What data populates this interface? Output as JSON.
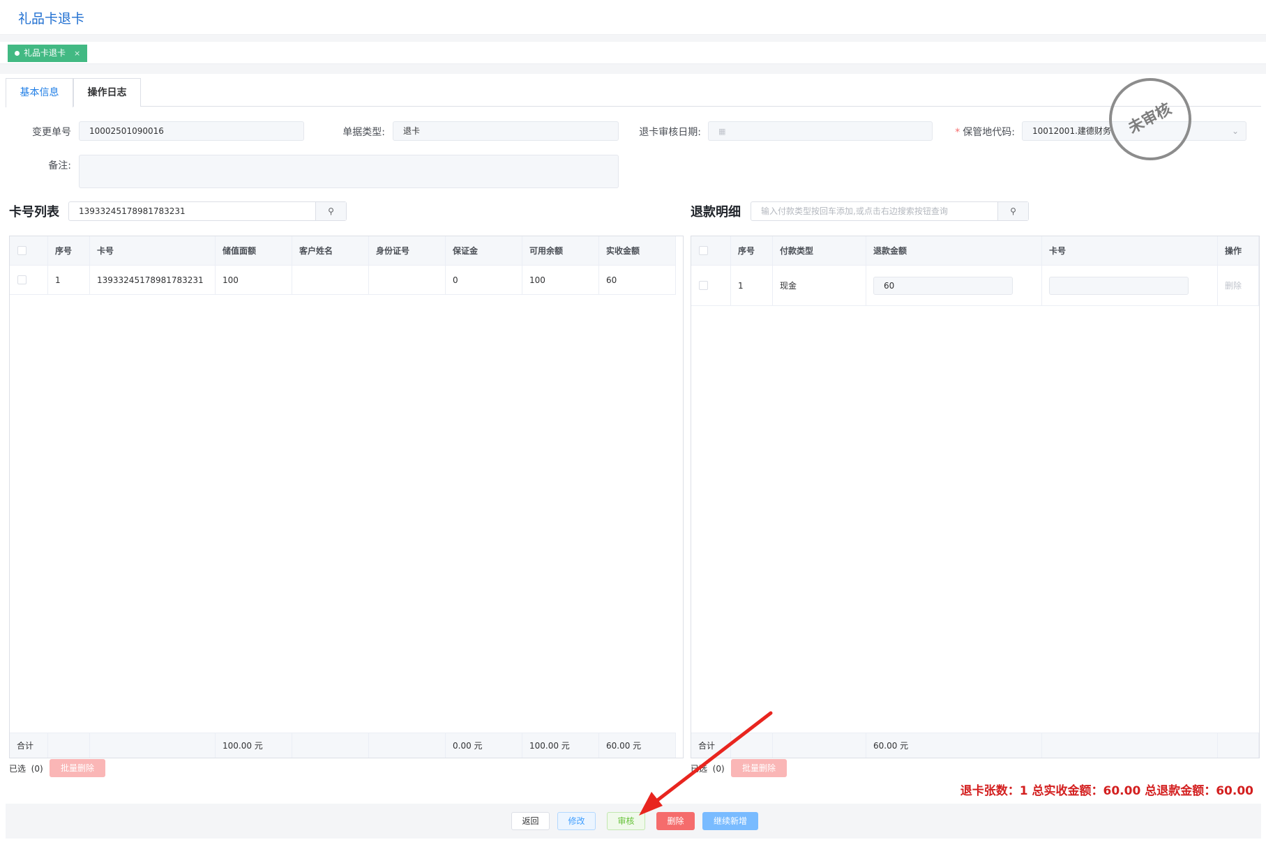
{
  "page": {
    "title": "礼品卡退卡"
  },
  "tags": [
    {
      "label": "礼品卡退卡",
      "close": "×"
    }
  ],
  "tabs": [
    {
      "label": "基本信息"
    },
    {
      "label": "操作日志"
    }
  ],
  "form": {
    "change_no": {
      "label": "变更单号",
      "value": "10002501090016"
    },
    "doc_type": {
      "label": "单据类型:",
      "value": "退卡"
    },
    "audit_date": {
      "label": "退卡审核日期:",
      "value": ""
    },
    "storage_code": {
      "required": "*",
      "label": "保管地代码:",
      "value": "10012001.建德财务"
    },
    "remark": {
      "label": "备注:",
      "value": ""
    }
  },
  "stamp": {
    "text": "未审核"
  },
  "card_list": {
    "title": "卡号列表",
    "search_value": "13933245178981783231",
    "columns": [
      "序号",
      "卡号",
      "储值面额",
      "客户姓名",
      "身份证号",
      "保证金",
      "可用余额",
      "实收金额"
    ],
    "rows": [
      {
        "no": "1",
        "card": "13933245178981783231",
        "face": "100",
        "name": "",
        "id": "",
        "deposit": "0",
        "balance": "100",
        "received": "60"
      }
    ],
    "footer": {
      "label": "合计",
      "face": "100.00 元",
      "deposit": "0.00 元",
      "balance": "100.00 元",
      "received": "60.00 元"
    },
    "selected_label": "已选",
    "selected_count": "(0)",
    "batch_delete": "批量删除"
  },
  "refund_detail": {
    "title": "退款明细",
    "search_placeholder": "输入付款类型按回车添加,或点击右边搜索按钮查询",
    "columns": [
      "序号",
      "付款类型",
      "退款金额",
      "卡号",
      "操作"
    ],
    "rows": [
      {
        "no": "1",
        "pay_type": "现金",
        "amount": "60",
        "card": "",
        "op": "删除"
      }
    ],
    "footer": {
      "label": "合计",
      "amount": "60.00 元"
    },
    "selected_label": "已选",
    "selected_count": "(0)",
    "batch_delete": "批量删除"
  },
  "summary": "退卡张数：1  总实收金额：60.00  总退款金额：60.00",
  "actions": {
    "back": "返回",
    "edit": "修改",
    "audit": "审核",
    "delete": "删除",
    "continue_new": "继续新增"
  },
  "colors": {
    "primary": "#409eff",
    "success": "#67c23a",
    "danger": "#f56c6c",
    "tag": "#42b983",
    "summary": "#d31f1f",
    "arrow": "#e8251f"
  },
  "icons": {
    "search": "search-icon",
    "calendar": "calendar-icon",
    "chevron": "chevron-down-icon",
    "close": "close-icon"
  }
}
